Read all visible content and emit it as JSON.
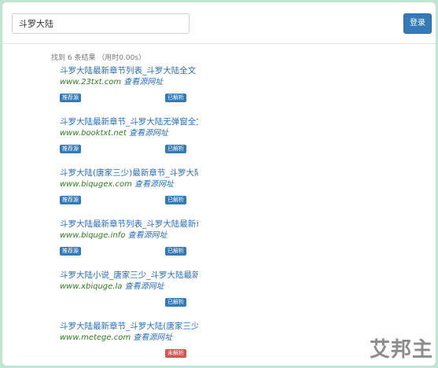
{
  "search": {
    "value": "斗罗大陆"
  },
  "login_label": "登录",
  "result_count": "找到 6 条结果 （用时0.00s）",
  "view_source_label": "查看源网址",
  "recommended_label": "推荐源",
  "results": [
    {
      "title": "斗罗大陆最新章节列表_斗罗大陆全文",
      "domain": "www.23txt.com",
      "recommended": true,
      "status": "已解析",
      "status_color": "#337ab7"
    },
    {
      "title": "斗罗大陆最新章节_斗罗大陆无弹窗全文",
      "domain": "www.booktxt.net",
      "recommended": true,
      "status": "已解析",
      "status_color": "#337ab7"
    },
    {
      "title": "斗罗大陆(唐家三少)最新章节_斗罗大陆",
      "domain": "www.biqugex.com",
      "recommended": true,
      "status": "已解析",
      "status_color": "#337ab7"
    },
    {
      "title": "斗罗大陆最新章节列表_斗罗大陆最新章",
      "domain": "www.biquge.info",
      "recommended": true,
      "status": "已解析",
      "status_color": "#337ab7"
    },
    {
      "title": "斗罗大陆小说_唐家三少_斗罗大陆最新",
      "domain": "www.xbiquge.la",
      "recommended": false,
      "status": "已解析",
      "status_color": "#337ab7"
    },
    {
      "title": "斗罗大陆最新章节_斗罗大陆(唐家三少",
      "domain": "www.metege.com",
      "recommended": false,
      "status": "未解析",
      "status_color": "#d9534f"
    }
  ],
  "watermark": "艾邦主"
}
